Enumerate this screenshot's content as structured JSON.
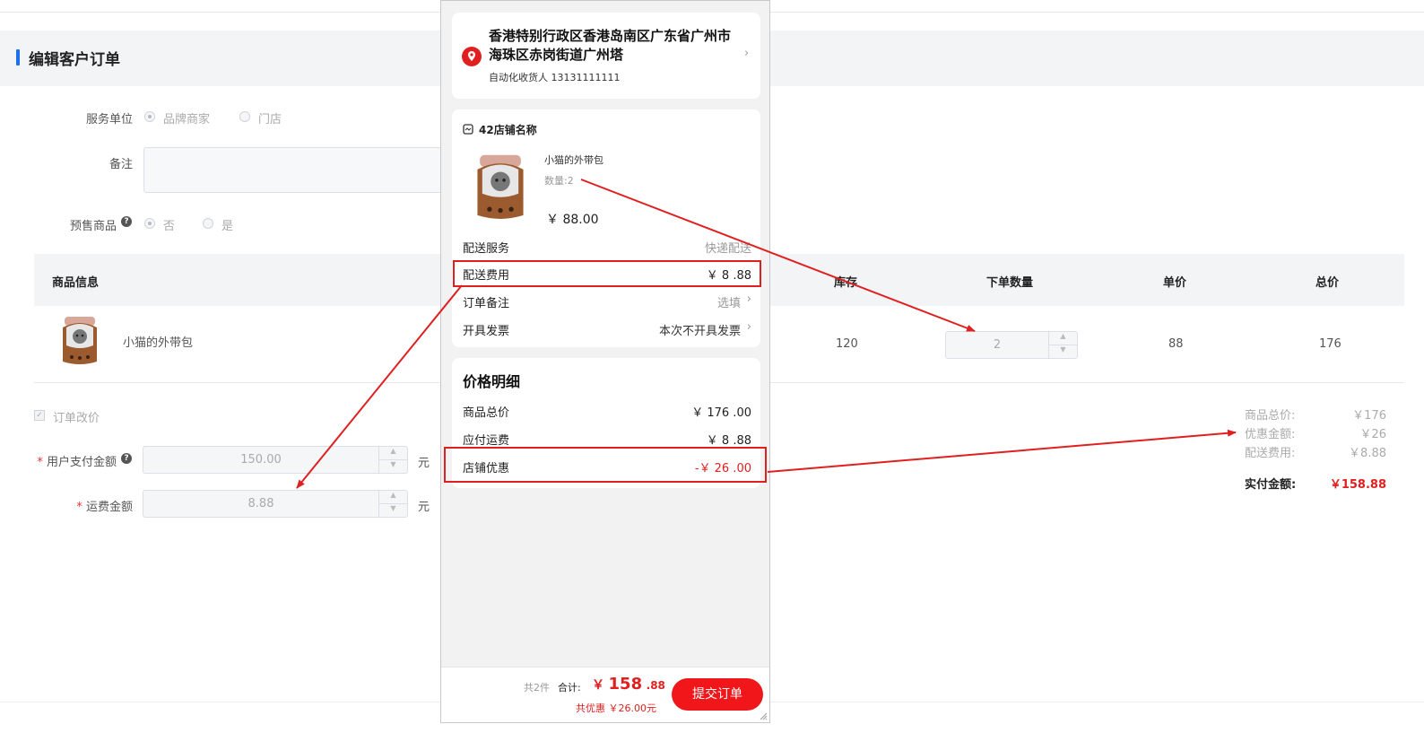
{
  "page": {
    "title": "编辑客户订单",
    "form": {
      "service_unit_label": "服务单位",
      "service_unit_options": [
        "品牌商家",
        "门店"
      ],
      "remark_label": "备注",
      "presale_label": "预售商品",
      "presale_options": [
        "否",
        "是"
      ]
    },
    "table": {
      "headers": [
        "商品信息",
        "库存",
        "下单数量",
        "单价",
        "总价"
      ],
      "rows": [
        {
          "name": "小猫的外带包",
          "stock": "120",
          "quantity": "2",
          "unit_price": "88",
          "total": "176"
        }
      ]
    },
    "price_change": {
      "checkbox_label": "订单改价",
      "user_pay_label": "用户支付金额",
      "user_pay_value": "150.00",
      "shipping_label": "运费金额",
      "shipping_value": "8.88",
      "unit": "元"
    },
    "summary": {
      "goods_total_label": "商品总价:",
      "goods_total_value": "￥176",
      "discount_label": "优惠金额:",
      "discount_value": "￥26",
      "shipping_label": "配送费用:",
      "shipping_value": "￥8.88",
      "paid_label": "实付金额:",
      "paid_value": "￥158.88"
    }
  },
  "phone": {
    "address": {
      "line": "香港特别行政区香港岛南区广东省广州市海珠区赤岗街道广州塔",
      "receiver": "自动化收货人 13131111111"
    },
    "store": {
      "name": "42店铺名称",
      "product_name": "小猫的外带包",
      "quantity": "数量:2",
      "price": "￥ 88.00"
    },
    "rows": {
      "delivery_service_label": "配送服务",
      "delivery_service_value": "快递配送",
      "delivery_fee_label": "配送费用",
      "delivery_fee_value": "￥ 8 .88",
      "order_note_label": "订单备注",
      "order_note_value": "选填",
      "invoice_label": "开具发票",
      "invoice_value": "本次不开具发票"
    },
    "price_detail": {
      "title": "价格明细",
      "goods_total_label": "商品总价",
      "goods_total_value": "￥ 176 .00",
      "shipping_label": "应付运费",
      "shipping_value": "￥ 8 .88",
      "store_discount_label": "店铺优惠",
      "store_discount_value": "-￥ 26 .00"
    },
    "footer": {
      "count": "共2件",
      "total_label": "合计:",
      "total_symbol": "￥",
      "total_int": "158",
      "total_dec": ".88",
      "saved": "共优惠 ￥26.00元",
      "submit_label": "提交订单"
    }
  },
  "colors": {
    "accent": "#1f6fe8",
    "red": "#e02020",
    "submit": "#f0161a"
  }
}
